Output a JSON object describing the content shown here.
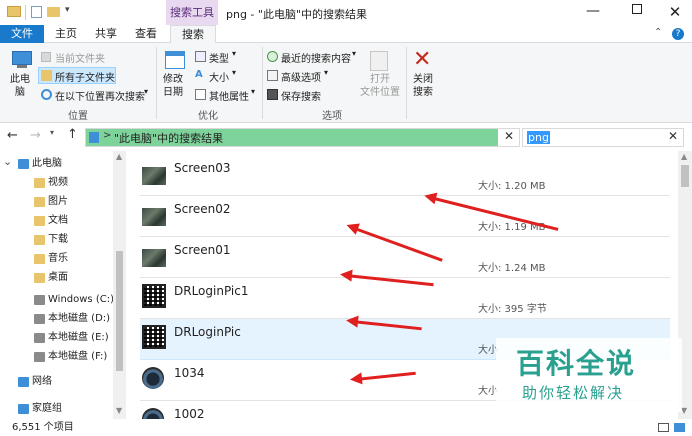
{
  "window": {
    "title": "png - \"此电脑\"中的搜索结果",
    "context_tab": "搜索工具"
  },
  "tabs": [
    "文件",
    "主页",
    "共享",
    "查看",
    "搜索"
  ],
  "ribbon": {
    "location_group": {
      "this_pc": "此电\n脑",
      "current_folder": "当前文件夹",
      "all_subfolders": "所有子文件夹",
      "search_again": "在以下位置再次搜索",
      "label": "位置"
    },
    "refine_group": {
      "modified_date": "修改\n日期",
      "kind": "类型",
      "size": "大小",
      "other_props": "其他属性",
      "label": "优化"
    },
    "options_group": {
      "recent": "最近的搜索内容",
      "advanced": "高级选项",
      "save": "保存搜索",
      "open_location": "打开\n文件位置",
      "label": "选项"
    },
    "close_search": "关闭\n搜索"
  },
  "address": {
    "path": "\"此电脑\"中的搜索结果",
    "search_value": "png"
  },
  "nav": [
    {
      "label": "此电脑",
      "icon": "pc-icon"
    },
    {
      "label": "视频",
      "icon": "video-folder-icon"
    },
    {
      "label": "图片",
      "icon": "picture-folder-icon"
    },
    {
      "label": "文档",
      "icon": "document-folder-icon"
    },
    {
      "label": "下载",
      "icon": "download-folder-icon"
    },
    {
      "label": "音乐",
      "icon": "music-folder-icon"
    },
    {
      "label": "桌面",
      "icon": "desktop-folder-icon"
    },
    {
      "label": "Windows (C:)",
      "icon": "drive-icon"
    },
    {
      "label": "本地磁盘 (D:)",
      "icon": "drive-icon"
    },
    {
      "label": "本地磁盘 (E:)",
      "icon": "drive-icon"
    },
    {
      "label": "本地磁盘 (F:)",
      "icon": "drive-icon"
    },
    {
      "label": "网络",
      "icon": "network-icon"
    },
    {
      "label": "家庭组",
      "icon": "homegroup-icon"
    }
  ],
  "files": [
    {
      "name": "Screen03",
      "size": "大小: 1.20 MB",
      "thumb": "game"
    },
    {
      "name": "Screen02",
      "size": "大小: 1.19 MB",
      "thumb": "game"
    },
    {
      "name": "Screen01",
      "size": "大小: 1.24 MB",
      "thumb": "game"
    },
    {
      "name": "DRLoginPic1",
      "size": "大小: 395 字节",
      "thumb": "qr"
    },
    {
      "name": "DRLoginPic",
      "size": "大小",
      "thumb": "qr"
    },
    {
      "name": "1034",
      "size": "大小",
      "thumb": "face"
    },
    {
      "name": "1002",
      "size": "",
      "thumb": "face"
    }
  ],
  "status": {
    "count": "6,551 个项目"
  },
  "watermark": {
    "title": "百科全说",
    "subtitle": "助你轻松解决"
  },
  "colors": {
    "accent": "#1979ca",
    "selected": "#cce8ff",
    "hover": "#e5f3ff",
    "arrow": "#e0201e",
    "search_tools": "#e8d9f0"
  }
}
